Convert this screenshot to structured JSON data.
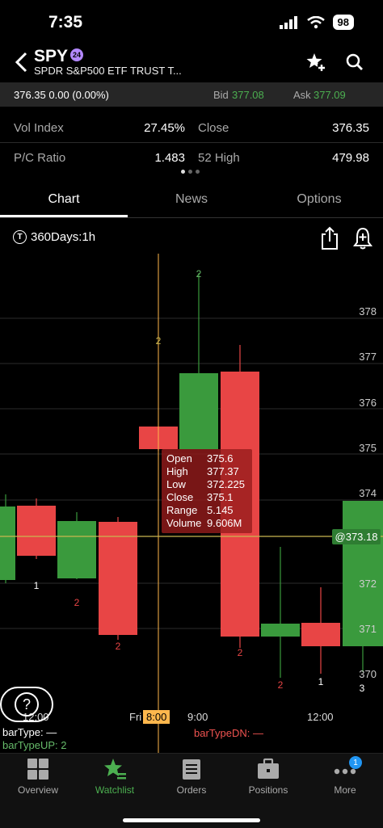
{
  "status": {
    "time": "7:35",
    "battery": "98"
  },
  "header": {
    "symbol": "SPY",
    "badge": "24",
    "fullname": "SPDR S&P500 ETF TRUST T..."
  },
  "quote": {
    "last": "376.35",
    "change": "0.00",
    "change_pct": "(0.00%)",
    "bid_label": "Bid",
    "bid": "377.08",
    "ask_label": "Ask",
    "ask": "377.09"
  },
  "stats": [
    {
      "label": "Vol Index",
      "value": "27.45%"
    },
    {
      "label": "Close",
      "value": "376.35"
    },
    {
      "label": "P/C Ratio",
      "value": "1.483"
    },
    {
      "label": "52 High",
      "value": "479.98"
    }
  ],
  "tabs": [
    {
      "label": "Chart"
    },
    {
      "label": "News"
    },
    {
      "label": "Options"
    }
  ],
  "chart": {
    "timeframe": "360Days:1h",
    "timeframe_icon": "T",
    "price_labels": [
      "378",
      "377",
      "376",
      "375",
      "374",
      "372",
      "371",
      "370"
    ],
    "current_price": "@373.18",
    "time_labels": [
      "12:00",
      "Fri",
      "9:00",
      "12:00"
    ],
    "crosshair_time": "8:00",
    "tooltip": [
      {
        "label": "Open",
        "value": "375.6"
      },
      {
        "label": "High",
        "value": "377.37"
      },
      {
        "label": "Low",
        "value": "372.225"
      },
      {
        "label": "Close",
        "value": "375.1"
      },
      {
        "label": "Range",
        "value": "5.145"
      },
      {
        "label": "Volume",
        "value": "9.606M"
      }
    ],
    "bar_type": "barType: —",
    "bar_type_up": "barTypeUP: 2",
    "bar_type_dn": "barTypeDN: —",
    "help": "?",
    "colors": {
      "up": "#3a9a3d",
      "down": "#e84545",
      "crosshair": "#ffb74d",
      "price_line": "#c9b74f"
    },
    "candle_labels": {
      "c1": "1",
      "c2": "2",
      "c3": "2",
      "c4": "2",
      "c5": "2",
      "c6": "2",
      "c7": "2",
      "c8": "1",
      "c9": "3"
    }
  },
  "nav": [
    {
      "label": "Overview",
      "icon": "overview-icon"
    },
    {
      "label": "Watchlist",
      "icon": "watchlist-star-icon"
    },
    {
      "label": "Orders",
      "icon": "orders-icon"
    },
    {
      "label": "Positions",
      "icon": "briefcase-icon"
    },
    {
      "label": "More",
      "icon": "more-dots-icon"
    }
  ],
  "more_badge": "1"
}
